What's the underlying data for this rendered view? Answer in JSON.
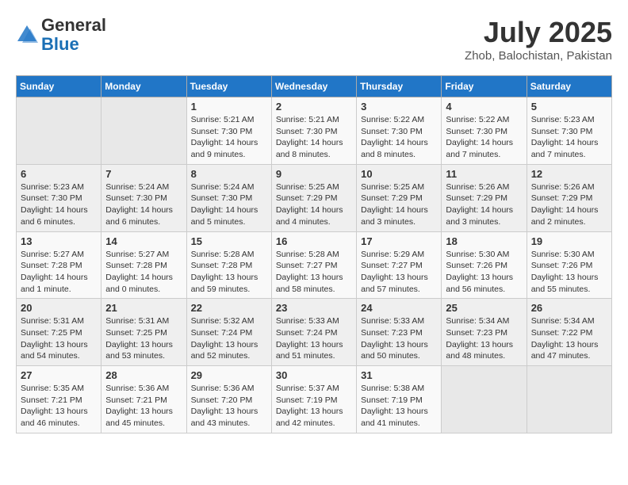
{
  "header": {
    "logo_general": "General",
    "logo_blue": "Blue",
    "title": "July 2025",
    "location": "Zhob, Balochistan, Pakistan"
  },
  "weekdays": [
    "Sunday",
    "Monday",
    "Tuesday",
    "Wednesday",
    "Thursday",
    "Friday",
    "Saturday"
  ],
  "weeks": [
    [
      {
        "day": "",
        "content": ""
      },
      {
        "day": "",
        "content": ""
      },
      {
        "day": "1",
        "content": "Sunrise: 5:21 AM\nSunset: 7:30 PM\nDaylight: 14 hours and 9 minutes."
      },
      {
        "day": "2",
        "content": "Sunrise: 5:21 AM\nSunset: 7:30 PM\nDaylight: 14 hours and 8 minutes."
      },
      {
        "day": "3",
        "content": "Sunrise: 5:22 AM\nSunset: 7:30 PM\nDaylight: 14 hours and 8 minutes."
      },
      {
        "day": "4",
        "content": "Sunrise: 5:22 AM\nSunset: 7:30 PM\nDaylight: 14 hours and 7 minutes."
      },
      {
        "day": "5",
        "content": "Sunrise: 5:23 AM\nSunset: 7:30 PM\nDaylight: 14 hours and 7 minutes."
      }
    ],
    [
      {
        "day": "6",
        "content": "Sunrise: 5:23 AM\nSunset: 7:30 PM\nDaylight: 14 hours and 6 minutes."
      },
      {
        "day": "7",
        "content": "Sunrise: 5:24 AM\nSunset: 7:30 PM\nDaylight: 14 hours and 6 minutes."
      },
      {
        "day": "8",
        "content": "Sunrise: 5:24 AM\nSunset: 7:30 PM\nDaylight: 14 hours and 5 minutes."
      },
      {
        "day": "9",
        "content": "Sunrise: 5:25 AM\nSunset: 7:29 PM\nDaylight: 14 hours and 4 minutes."
      },
      {
        "day": "10",
        "content": "Sunrise: 5:25 AM\nSunset: 7:29 PM\nDaylight: 14 hours and 3 minutes."
      },
      {
        "day": "11",
        "content": "Sunrise: 5:26 AM\nSunset: 7:29 PM\nDaylight: 14 hours and 3 minutes."
      },
      {
        "day": "12",
        "content": "Sunrise: 5:26 AM\nSunset: 7:29 PM\nDaylight: 14 hours and 2 minutes."
      }
    ],
    [
      {
        "day": "13",
        "content": "Sunrise: 5:27 AM\nSunset: 7:28 PM\nDaylight: 14 hours and 1 minute."
      },
      {
        "day": "14",
        "content": "Sunrise: 5:27 AM\nSunset: 7:28 PM\nDaylight: 14 hours and 0 minutes."
      },
      {
        "day": "15",
        "content": "Sunrise: 5:28 AM\nSunset: 7:28 PM\nDaylight: 13 hours and 59 minutes."
      },
      {
        "day": "16",
        "content": "Sunrise: 5:28 AM\nSunset: 7:27 PM\nDaylight: 13 hours and 58 minutes."
      },
      {
        "day": "17",
        "content": "Sunrise: 5:29 AM\nSunset: 7:27 PM\nDaylight: 13 hours and 57 minutes."
      },
      {
        "day": "18",
        "content": "Sunrise: 5:30 AM\nSunset: 7:26 PM\nDaylight: 13 hours and 56 minutes."
      },
      {
        "day": "19",
        "content": "Sunrise: 5:30 AM\nSunset: 7:26 PM\nDaylight: 13 hours and 55 minutes."
      }
    ],
    [
      {
        "day": "20",
        "content": "Sunrise: 5:31 AM\nSunset: 7:25 PM\nDaylight: 13 hours and 54 minutes."
      },
      {
        "day": "21",
        "content": "Sunrise: 5:31 AM\nSunset: 7:25 PM\nDaylight: 13 hours and 53 minutes."
      },
      {
        "day": "22",
        "content": "Sunrise: 5:32 AM\nSunset: 7:24 PM\nDaylight: 13 hours and 52 minutes."
      },
      {
        "day": "23",
        "content": "Sunrise: 5:33 AM\nSunset: 7:24 PM\nDaylight: 13 hours and 51 minutes."
      },
      {
        "day": "24",
        "content": "Sunrise: 5:33 AM\nSunset: 7:23 PM\nDaylight: 13 hours and 50 minutes."
      },
      {
        "day": "25",
        "content": "Sunrise: 5:34 AM\nSunset: 7:23 PM\nDaylight: 13 hours and 48 minutes."
      },
      {
        "day": "26",
        "content": "Sunrise: 5:34 AM\nSunset: 7:22 PM\nDaylight: 13 hours and 47 minutes."
      }
    ],
    [
      {
        "day": "27",
        "content": "Sunrise: 5:35 AM\nSunset: 7:21 PM\nDaylight: 13 hours and 46 minutes."
      },
      {
        "day": "28",
        "content": "Sunrise: 5:36 AM\nSunset: 7:21 PM\nDaylight: 13 hours and 45 minutes."
      },
      {
        "day": "29",
        "content": "Sunrise: 5:36 AM\nSunset: 7:20 PM\nDaylight: 13 hours and 43 minutes."
      },
      {
        "day": "30",
        "content": "Sunrise: 5:37 AM\nSunset: 7:19 PM\nDaylight: 13 hours and 42 minutes."
      },
      {
        "day": "31",
        "content": "Sunrise: 5:38 AM\nSunset: 7:19 PM\nDaylight: 13 hours and 41 minutes."
      },
      {
        "day": "",
        "content": ""
      },
      {
        "day": "",
        "content": ""
      }
    ]
  ]
}
